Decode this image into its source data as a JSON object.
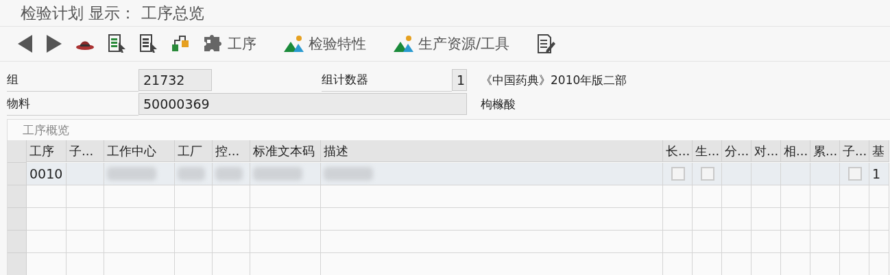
{
  "window": {
    "title": "检验计划 显示： 工序总览"
  },
  "toolbar": [
    {
      "kind": "back"
    },
    {
      "kind": "forward"
    },
    {
      "kind": "hat"
    },
    {
      "kind": "doc-green"
    },
    {
      "kind": "doc"
    },
    {
      "kind": "hierarchy"
    },
    {
      "kind": "puzzle",
      "label": "工序"
    },
    {
      "kind": "mountain",
      "label": "检验特性"
    },
    {
      "kind": "mountain",
      "label": "生产资源/工具"
    },
    {
      "kind": "edit"
    }
  ],
  "header": {
    "group_label": "组",
    "group_value": "21732",
    "counter_label": "组计数器",
    "counter_value": "1",
    "pharmacopoeia": "《中国药典》2010年版二部",
    "material_label": "物料",
    "material_value": "50000369",
    "material_name": "枸橼酸"
  },
  "section": {
    "title": "工序概览"
  },
  "table": {
    "columns": [
      "工序",
      "子...",
      "工作中心",
      "工厂",
      "控...",
      "标准文本码",
      "描述",
      "长...",
      "生...",
      "分...",
      "对...",
      "相...",
      "累...",
      "子...",
      "基"
    ],
    "rows": [
      {
        "cells": [
          {
            "kind": "text",
            "text": "0010"
          },
          {
            "kind": "empty"
          },
          {
            "kind": "blurred"
          },
          {
            "kind": "blurred"
          },
          {
            "kind": "blurred"
          },
          {
            "kind": "blurred"
          },
          {
            "kind": "blurred"
          },
          {
            "kind": "checkbox",
            "checked": false
          },
          {
            "kind": "checkbox",
            "checked": false
          },
          {
            "kind": "empty"
          },
          {
            "kind": "empty"
          },
          {
            "kind": "empty"
          },
          {
            "kind": "empty"
          },
          {
            "kind": "checkbox",
            "checked": false
          },
          {
            "kind": "text",
            "text": "1"
          }
        ]
      }
    ]
  }
}
